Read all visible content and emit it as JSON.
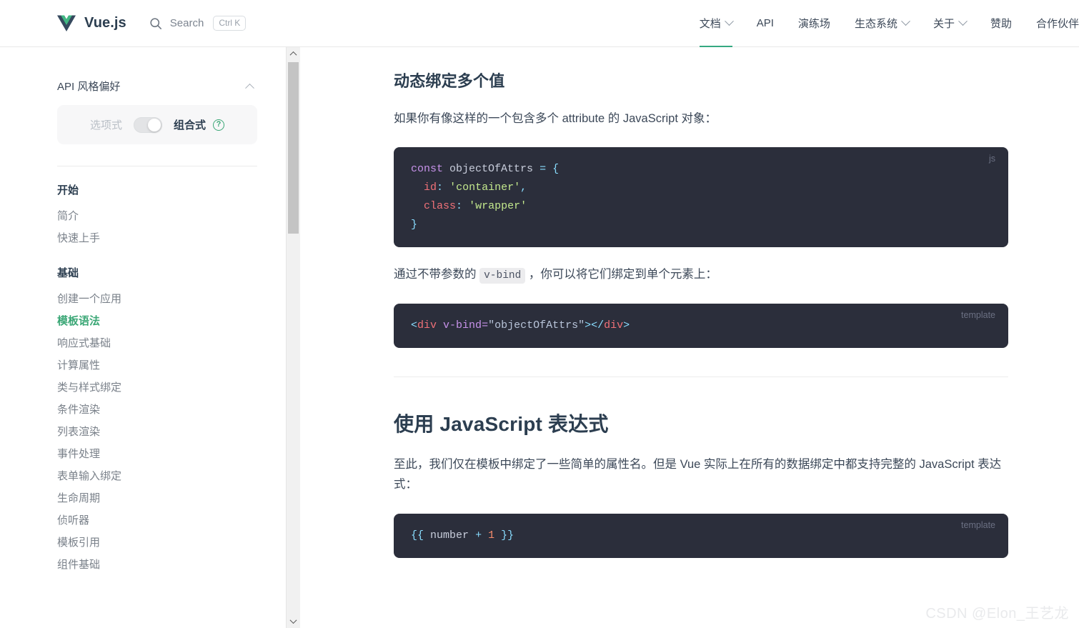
{
  "header": {
    "brand": "Vue.js",
    "logo_icon": "vue-logo-icon",
    "search": {
      "icon": "search-icon",
      "label": "Search",
      "shortcut": "Ctrl K"
    },
    "nav": [
      {
        "label": "文档",
        "has_chevron": true,
        "active": true
      },
      {
        "label": "API",
        "has_chevron": false,
        "active": false
      },
      {
        "label": "演练场",
        "has_chevron": false,
        "active": false
      },
      {
        "label": "生态系统",
        "has_chevron": true,
        "active": false
      },
      {
        "label": "关于",
        "has_chevron": true,
        "active": false
      },
      {
        "label": "赞助",
        "has_chevron": false,
        "active": false
      },
      {
        "label": "合作伙伴",
        "has_chevron": false,
        "active": false
      }
    ]
  },
  "sidebar": {
    "api_preference": {
      "title": "API 风格偏好",
      "collapse_icon": "chevron-up-icon",
      "option_label": "选项式",
      "composition_label": "组合式",
      "help_icon": "question-mark-icon",
      "help_glyph": "?",
      "toggle_state": "composition"
    },
    "groups": [
      {
        "title": "开始",
        "items": [
          {
            "label": "简介",
            "active": false
          },
          {
            "label": "快速上手",
            "active": false
          }
        ]
      },
      {
        "title": "基础",
        "items": [
          {
            "label": "创建一个应用",
            "active": false
          },
          {
            "label": "模板语法",
            "active": true
          },
          {
            "label": "响应式基础",
            "active": false
          },
          {
            "label": "计算属性",
            "active": false
          },
          {
            "label": "类与样式绑定",
            "active": false
          },
          {
            "label": "条件渲染",
            "active": false
          },
          {
            "label": "列表渲染",
            "active": false
          },
          {
            "label": "事件处理",
            "active": false
          },
          {
            "label": "表单输入绑定",
            "active": false
          },
          {
            "label": "生命周期",
            "active": false
          },
          {
            "label": "侦听器",
            "active": false
          },
          {
            "label": "模板引用",
            "active": false
          },
          {
            "label": "组件基础",
            "active": false
          }
        ]
      }
    ]
  },
  "scrollbar": {
    "up_icon": "chevron-up-icon",
    "down_icon": "chevron-down-icon"
  },
  "main": {
    "heading_dynamic_bind": "动态绑定多个值",
    "para_object": "如果你有像这样的一个包含多个 attribute 的 JavaScript 对象：",
    "code_js": {
      "lang": "js",
      "line1_kw": "const",
      "line1_var": "objectOfAttrs",
      "line1_eq": "=",
      "line1_brace": "{",
      "line2_prop": "id",
      "line2_colon": ":",
      "line2_str": "'container'",
      "line2_comma": ",",
      "line3_prop": "class",
      "line3_colon": ":",
      "line3_str": "'wrapper'",
      "line4_brace": "}"
    },
    "para_vbind_prefix": "通过不带参数的",
    "para_vbind_code": "v-bind",
    "para_vbind_suffix": "，你可以将它们绑定到单个元素上：",
    "code_template_1": {
      "lang": "template",
      "open_lt": "<",
      "open_tag": "div",
      "attr": "v-bind",
      "eq": "=",
      "value": "\"objectOfAttrs\"",
      "gt": ">",
      "close_lt": "</",
      "close_tag": "div",
      "close_gt": ">"
    },
    "heading_js_expr": "使用 JavaScript 表达式",
    "para_js_expr": "至此，我们仅在模板中绑定了一些简单的属性名。但是 Vue 实际上在所有的数据绑定中都支持完整的 JavaScript 表达式：",
    "code_template_2": {
      "lang": "template",
      "open": "{{",
      "ident": "number",
      "op": "+",
      "num": "1",
      "close": "}}"
    }
  },
  "watermark": "CSDN @Elon_王艺龙",
  "colors": {
    "accent_green": "#3ba776",
    "heading": "#2c3e50",
    "code_bg": "#2b2e3b",
    "text": "#3c4858"
  }
}
